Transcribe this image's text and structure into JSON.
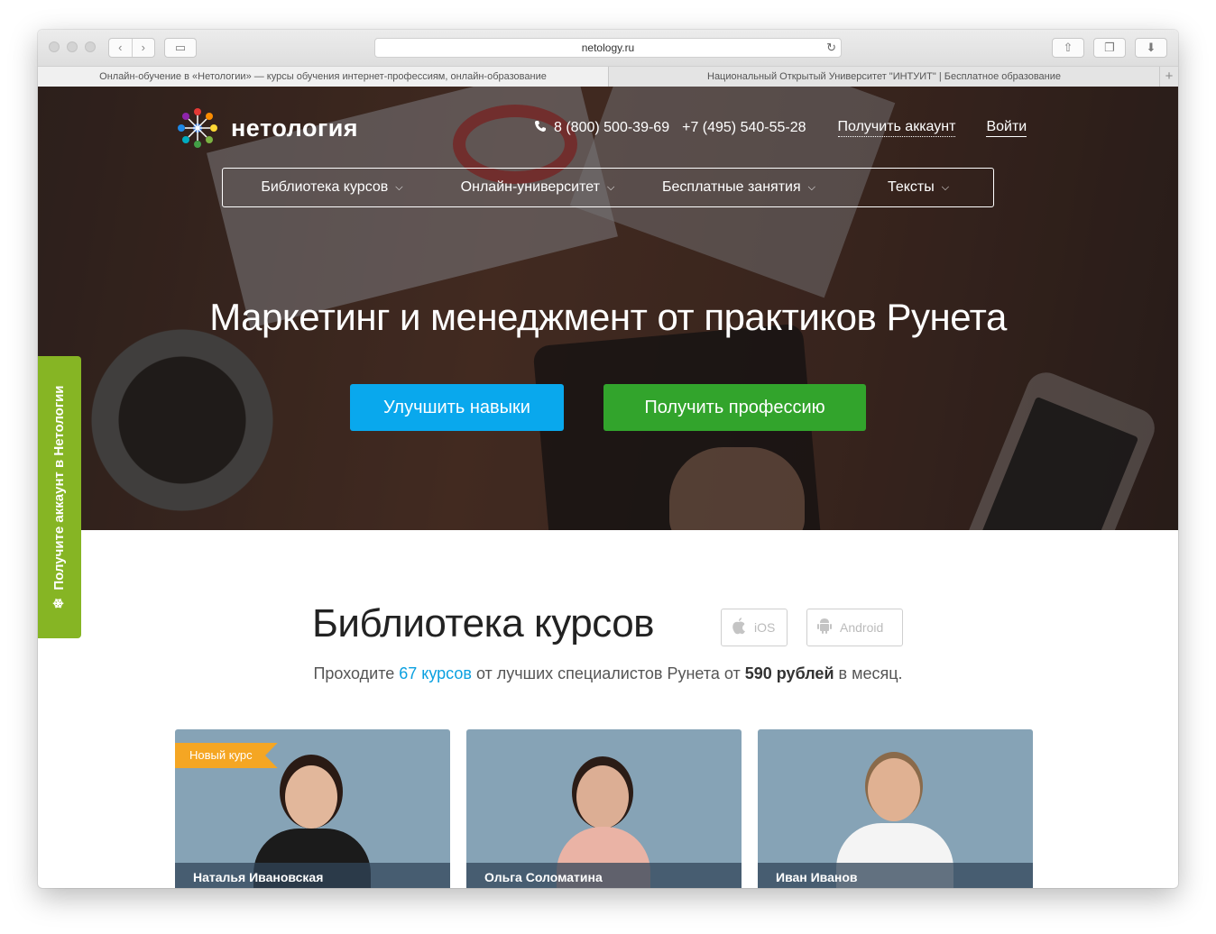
{
  "browser": {
    "url": "netology.ru",
    "tabs": [
      {
        "title": "Онлайн-обучение в «Нетологии» — курсы обучения интернет-профессиям, онлайн-образование",
        "active": true
      },
      {
        "title": "Национальный Открытый Университет \"ИНТУИТ\" | Бесплатное образование",
        "active": false
      }
    ],
    "new_tab": "+"
  },
  "header": {
    "logo_text": "нетология",
    "phone1": "8 (800) 500-39-69",
    "phone2": "+7 (495) 540-55-28",
    "get_account": "Получить аккаунт",
    "login": "Войти"
  },
  "menu": [
    {
      "label": "Библиотека курсов"
    },
    {
      "label": "Онлайн-университет"
    },
    {
      "label": "Бесплатные занятия"
    },
    {
      "label": "Тексты"
    }
  ],
  "hero": {
    "title": "Маркетинг и менеджмент от практиков Рунета",
    "btn_skills": "Улучшить навыки",
    "btn_profession": "Получить профессию",
    "colors": {
      "blue": "#09a8ed",
      "green": "#32a42c"
    }
  },
  "side_tab": {
    "label": "Получите аккаунт в Нетологии",
    "color": "#86b524"
  },
  "library": {
    "title": "Библиотека курсов",
    "ios": "iOS",
    "android": "Android",
    "sub_prefix": "Проходите ",
    "sub_link": "67 курсов",
    "sub_middle": " от лучших специалистов Рунета от ",
    "sub_price": "590 рублей",
    "sub_suffix": " в месяц."
  },
  "cards": [
    {
      "name": "Наталья Ивановская",
      "badge": "Новый курс"
    },
    {
      "name": "Ольга Соломатина"
    },
    {
      "name": "Иван Иванов"
    }
  ]
}
